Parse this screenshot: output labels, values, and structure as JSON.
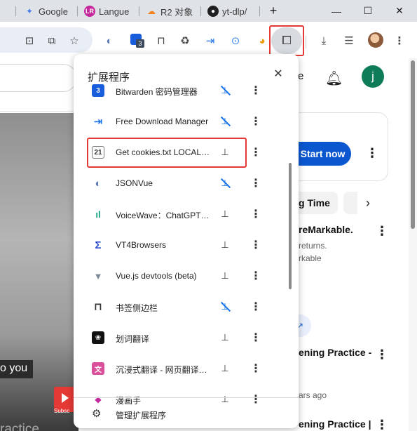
{
  "tabs": [
    {
      "label": "Google",
      "icon": "sparkle-icon",
      "color": "#4c7dea"
    },
    {
      "label": "Langue",
      "icon": "lr-logo-icon",
      "color": "#c3279b"
    },
    {
      "label": "R2 对象",
      "icon": "cloudflare-icon",
      "color": "#f48120"
    },
    {
      "label": "yt-dlp/",
      "icon": "github-icon",
      "color": "#1f1f1f"
    }
  ],
  "new_tab_label": "+",
  "window_controls": {
    "minimize": "—",
    "maximize": "☐",
    "close": "✕"
  },
  "toolbar": {
    "extension_badge": "3"
  },
  "popup": {
    "title": "扩展程序",
    "close_label": "✕",
    "extensions": [
      {
        "name": "Bitwarden 密码管理器",
        "icon": "bitwarden-icon",
        "icon_glyph": "3",
        "pinned": false
      },
      {
        "name": "Free Download Manager",
        "icon": "fdm-icon",
        "icon_glyph": "⇥",
        "pinned": false
      },
      {
        "name": "Get cookies.txt LOCALLY",
        "icon": "cookie-icon",
        "icon_glyph": "21",
        "pinned": true
      },
      {
        "name": "JSONVue",
        "icon": "jsonvue-icon",
        "icon_glyph": "◐",
        "pinned": false
      },
      {
        "name": "VoiceWave：ChatGPT Voice Control",
        "icon": "voicewave-icon",
        "icon_glyph": "ıl",
        "pinned": true
      },
      {
        "name": "VT4Browsers",
        "icon": "vt4-icon",
        "icon_glyph": "Σ",
        "pinned": true
      },
      {
        "name": "Vue.js devtools (beta)",
        "icon": "vue-icon",
        "icon_glyph": "▼",
        "pinned": true
      },
      {
        "name": "书签侧边栏",
        "icon": "bookmark-icon",
        "icon_glyph": "⊓",
        "pinned": false
      },
      {
        "name": "划词翻译",
        "icon": "huaci-icon",
        "icon_glyph": "❀",
        "pinned": true
      },
      {
        "name": "沉浸式翻译 - 网页翻译插件",
        "icon": "immersive-translate-icon",
        "icon_glyph": "文",
        "pinned": true
      },
      {
        "name": "漫画手",
        "icon": "extension-icon",
        "icon_glyph": "◆",
        "pinned": true
      }
    ],
    "manage_label": "管理扩展程序"
  },
  "page": {
    "search_placeholder": "e",
    "caption": "o you",
    "watermark": "ractice",
    "subscribe_label": "Subsc",
    "start_button": "Start now",
    "chip_label": "g Time",
    "items": [
      {
        "title": "reMarkable.",
        "sub1": "returns.",
        "sub2": "rkable"
      },
      {
        "title": "ening Practice -",
        "sub1": "ars ago"
      },
      {
        "title": "ening Practice |"
      }
    ]
  },
  "colors": {
    "highlight": "#e53935",
    "accent_blue": "#0b57d0",
    "avatar_green": "#0e7c58",
    "pin_blue": "#1a73e8"
  },
  "avatar_letter": "j"
}
